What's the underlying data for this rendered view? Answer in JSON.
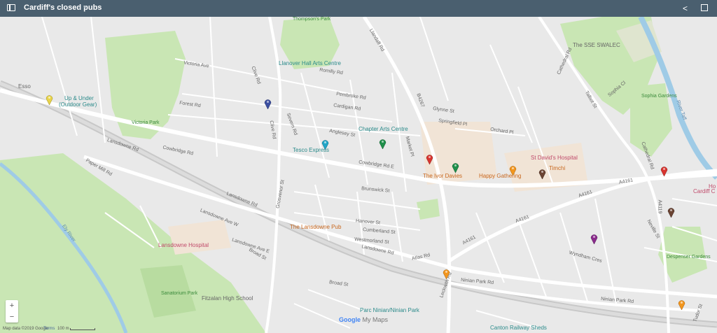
{
  "app": {
    "title": "Cardiff's closed pubs"
  },
  "icons": {
    "menu": "sidebar-toggle-icon",
    "caret": "caret-down-icon",
    "share": "share-icon",
    "fullscreen": "fullscreen-icon"
  },
  "map": {
    "parks": [
      "Thompson's Park",
      "Victoria Park",
      "Sophia Gardens",
      "Despenser Gardens",
      "Sanatorium Park"
    ],
    "pois": {
      "llanover": "Llanover Hall Arts Centre",
      "upunder1": "Up & Under",
      "upunder2": "(Outdoor Gear)",
      "esso": "Esso",
      "chapter": "Chapter Arts Centre",
      "tesco": "Tesco Express",
      "ivor": "The Ivor Davies",
      "happy": "Happy Gathering",
      "stdavids": "St David's Hospital",
      "lansdownepub": "The Lansdowne Pub",
      "lansdownehosp": "Lansdowne Hospital",
      "fitzalan": "Fitzalan High School",
      "parcninian": "Parc Ninian/Ninian Park",
      "canton": "Canton Railway Sheds",
      "sse": "The SSE SWALEC",
      "cardiffc": "Cardiff C",
      "hol": "Ho",
      "timchi": "Timchi"
    },
    "roads": {
      "cowbridge": "Cowbridge Rd",
      "cowbridgeE": "Cowbridge Rd E",
      "lansdowne": "Lansdowne Rd",
      "broadst": "Broad St",
      "broadst2": "Broad St",
      "ninian": "Ninian Park Rd",
      "ninian2": "Ninian Park Rd",
      "atlas": "Atlas Rd",
      "a4161a": "A4161",
      "a4161b": "A4161",
      "a4161c": "A4161",
      "a4161d": "A4161",
      "a4119": "A4119",
      "cathedral": "Cathedral Rd",
      "cathedral2": "Cathedral Rd",
      "llandaff": "Llandaff Rd",
      "clive": "Clive Rd",
      "grosvenor": "Grosvenor St",
      "romilly": "Romilly Rd",
      "victoria": "Victoria Ave",
      "ely": "Ely River",
      "taff": "River Taff",
      "wyndham": "Wyndham Cres",
      "neville": "Neville St",
      "tudor": "Tudor St",
      "b4267": "B4267",
      "forest": "Forest Rd",
      "pembroke": "Pembroke Rd",
      "cardigan": "Cardigan Rd",
      "anglesey": "Anglesey St",
      "springfield": "Springfield Pl",
      "orchard": "Orchard Pl",
      "glynne": "Glynne St",
      "hanover": "Hanover St",
      "brunswick": "Brunswick St",
      "severn": "Severn Rd",
      "lansdowneave": "Lansdowne Ave W",
      "lansdowneaveE": "Lansdowne Ave E",
      "paper": "Paper Mill Rd",
      "market": "Market Pl",
      "talbot": "Talbot St",
      "sophia": "Sophia Cl",
      "westmorland": "Westmorland St",
      "cumberland": "Cumberland St",
      "leckwith": "Leckwith Rd"
    },
    "pins": [
      {
        "color": "#e8d44a",
        "name": "pub-pin-yellow"
      },
      {
        "color": "#3c4fa0",
        "name": "pub-pin-blue"
      },
      {
        "color": "#21a6c7",
        "name": "pub-pin-cyan"
      },
      {
        "color": "#1f8f4a",
        "name": "pub-pin-green-1"
      },
      {
        "color": "#1f8f4a",
        "name": "pub-pin-green-2"
      },
      {
        "color": "#d8342f",
        "name": "pub-pin-red-1"
      },
      {
        "color": "#f2961e",
        "name": "pub-pin-orange-1"
      },
      {
        "color": "#6b4433",
        "name": "pub-pin-brown-1"
      },
      {
        "color": "#d8342f",
        "name": "pub-pin-red-2"
      },
      {
        "color": "#6b4433",
        "name": "pub-pin-brown-2"
      },
      {
        "color": "#8a2b8c",
        "name": "pub-pin-purple"
      },
      {
        "color": "#f2961e",
        "name": "pub-pin-orange-2"
      },
      {
        "color": "#f2961e",
        "name": "pub-pin-orange-3"
      }
    ]
  },
  "controls": {
    "zoom_in": "+",
    "zoom_out": "−"
  },
  "footer": {
    "attribution": "Map data ©2019 Google",
    "terms": "Terms",
    "scale": "100 m"
  },
  "branding": {
    "google": "Google",
    "mymaps": "My Maps"
  }
}
